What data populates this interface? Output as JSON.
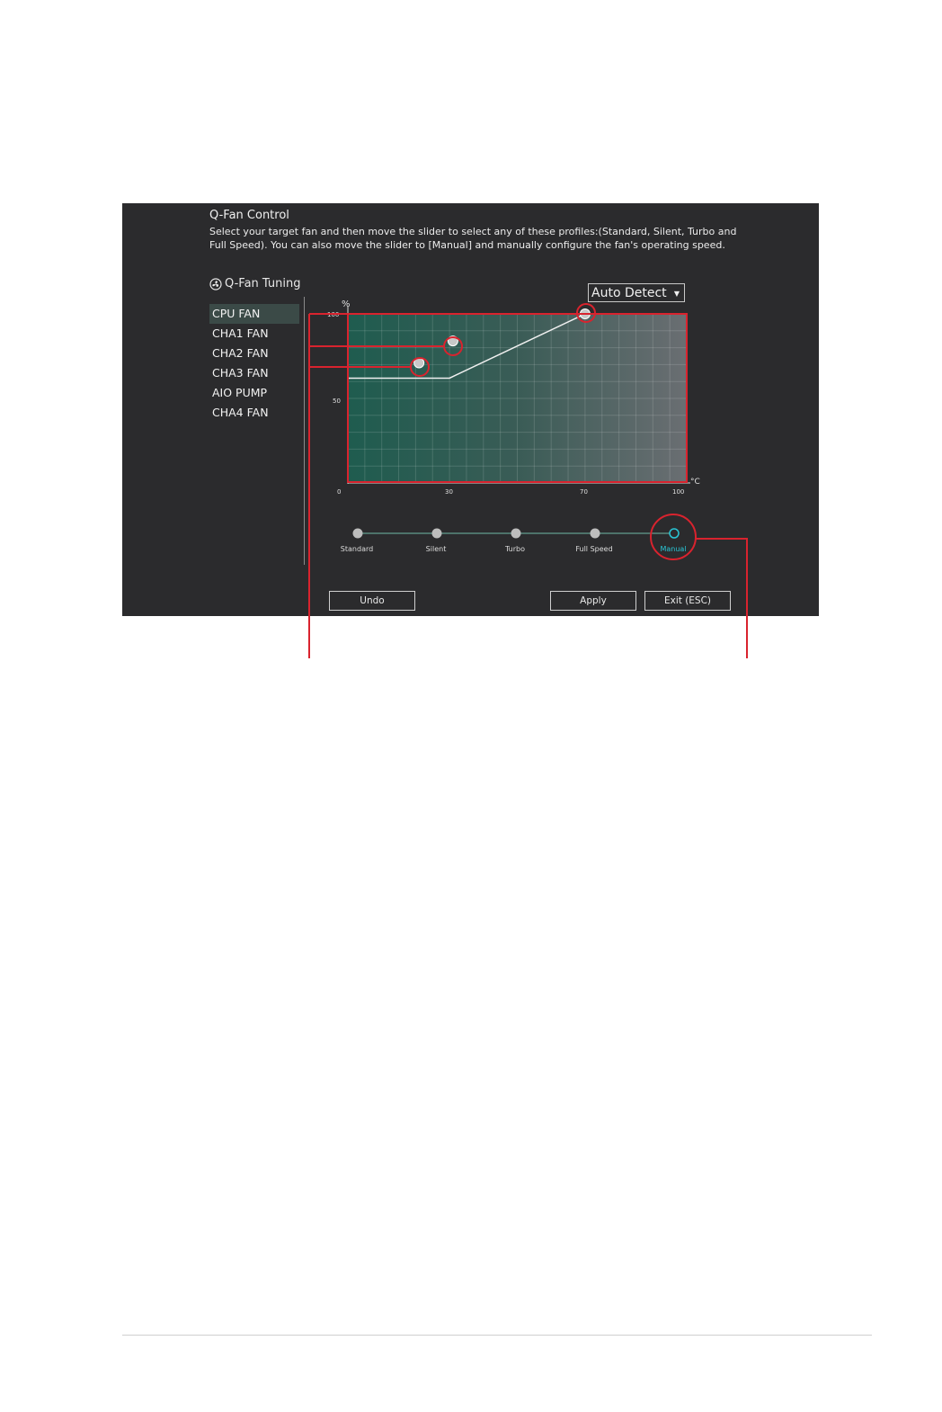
{
  "window": {
    "title": "Q-Fan Control",
    "description": "Select your target fan and then move the slider to select any of these profiles:(Standard, Silent, Turbo and Full Speed). You can also move the slider to [Manual] and manually configure the fan's operating speed."
  },
  "tuning": {
    "title": "Q-Fan Tuning",
    "icon": "fan-icon"
  },
  "fans": [
    {
      "label": "CPU FAN",
      "selected": true
    },
    {
      "label": "CHA1 FAN",
      "selected": false
    },
    {
      "label": "CHA2 FAN",
      "selected": false
    },
    {
      "label": "CHA3 FAN",
      "selected": false
    },
    {
      "label": "AIO PUMP",
      "selected": false
    },
    {
      "label": "CHA4 FAN",
      "selected": false
    }
  ],
  "dropdown": {
    "value": "Auto Detect",
    "icon": "chevron-down-icon"
  },
  "chart_data": {
    "type": "line",
    "ylabel": "%",
    "xlabel": "°C",
    "x_ticks": [
      0,
      30,
      70,
      100
    ],
    "y_ticks": [
      50,
      100
    ],
    "xlim": [
      0,
      100
    ],
    "ylim": [
      0,
      100
    ],
    "grid": true,
    "series": [
      {
        "x": [
          0,
          30,
          70
        ],
        "y": [
          62,
          62,
          100
        ]
      }
    ],
    "control_points": [
      {
        "x": 21,
        "y": 71
      },
      {
        "x": 31,
        "y": 84
      },
      {
        "x": 70,
        "y": 100
      }
    ]
  },
  "profiles": {
    "items": [
      "Standard",
      "Silent",
      "Turbo",
      "Full Speed",
      "Manual"
    ],
    "selected": "Manual",
    "accent_color": "#29c6d6"
  },
  "buttons": {
    "undo": "Undo",
    "apply": "Apply",
    "exit": "Exit (ESC)"
  },
  "colors": {
    "annotation": "#d9232e",
    "background": "#2b2b2d",
    "plot_start": "#1f5c4f",
    "plot_end": "#6a6e72"
  }
}
